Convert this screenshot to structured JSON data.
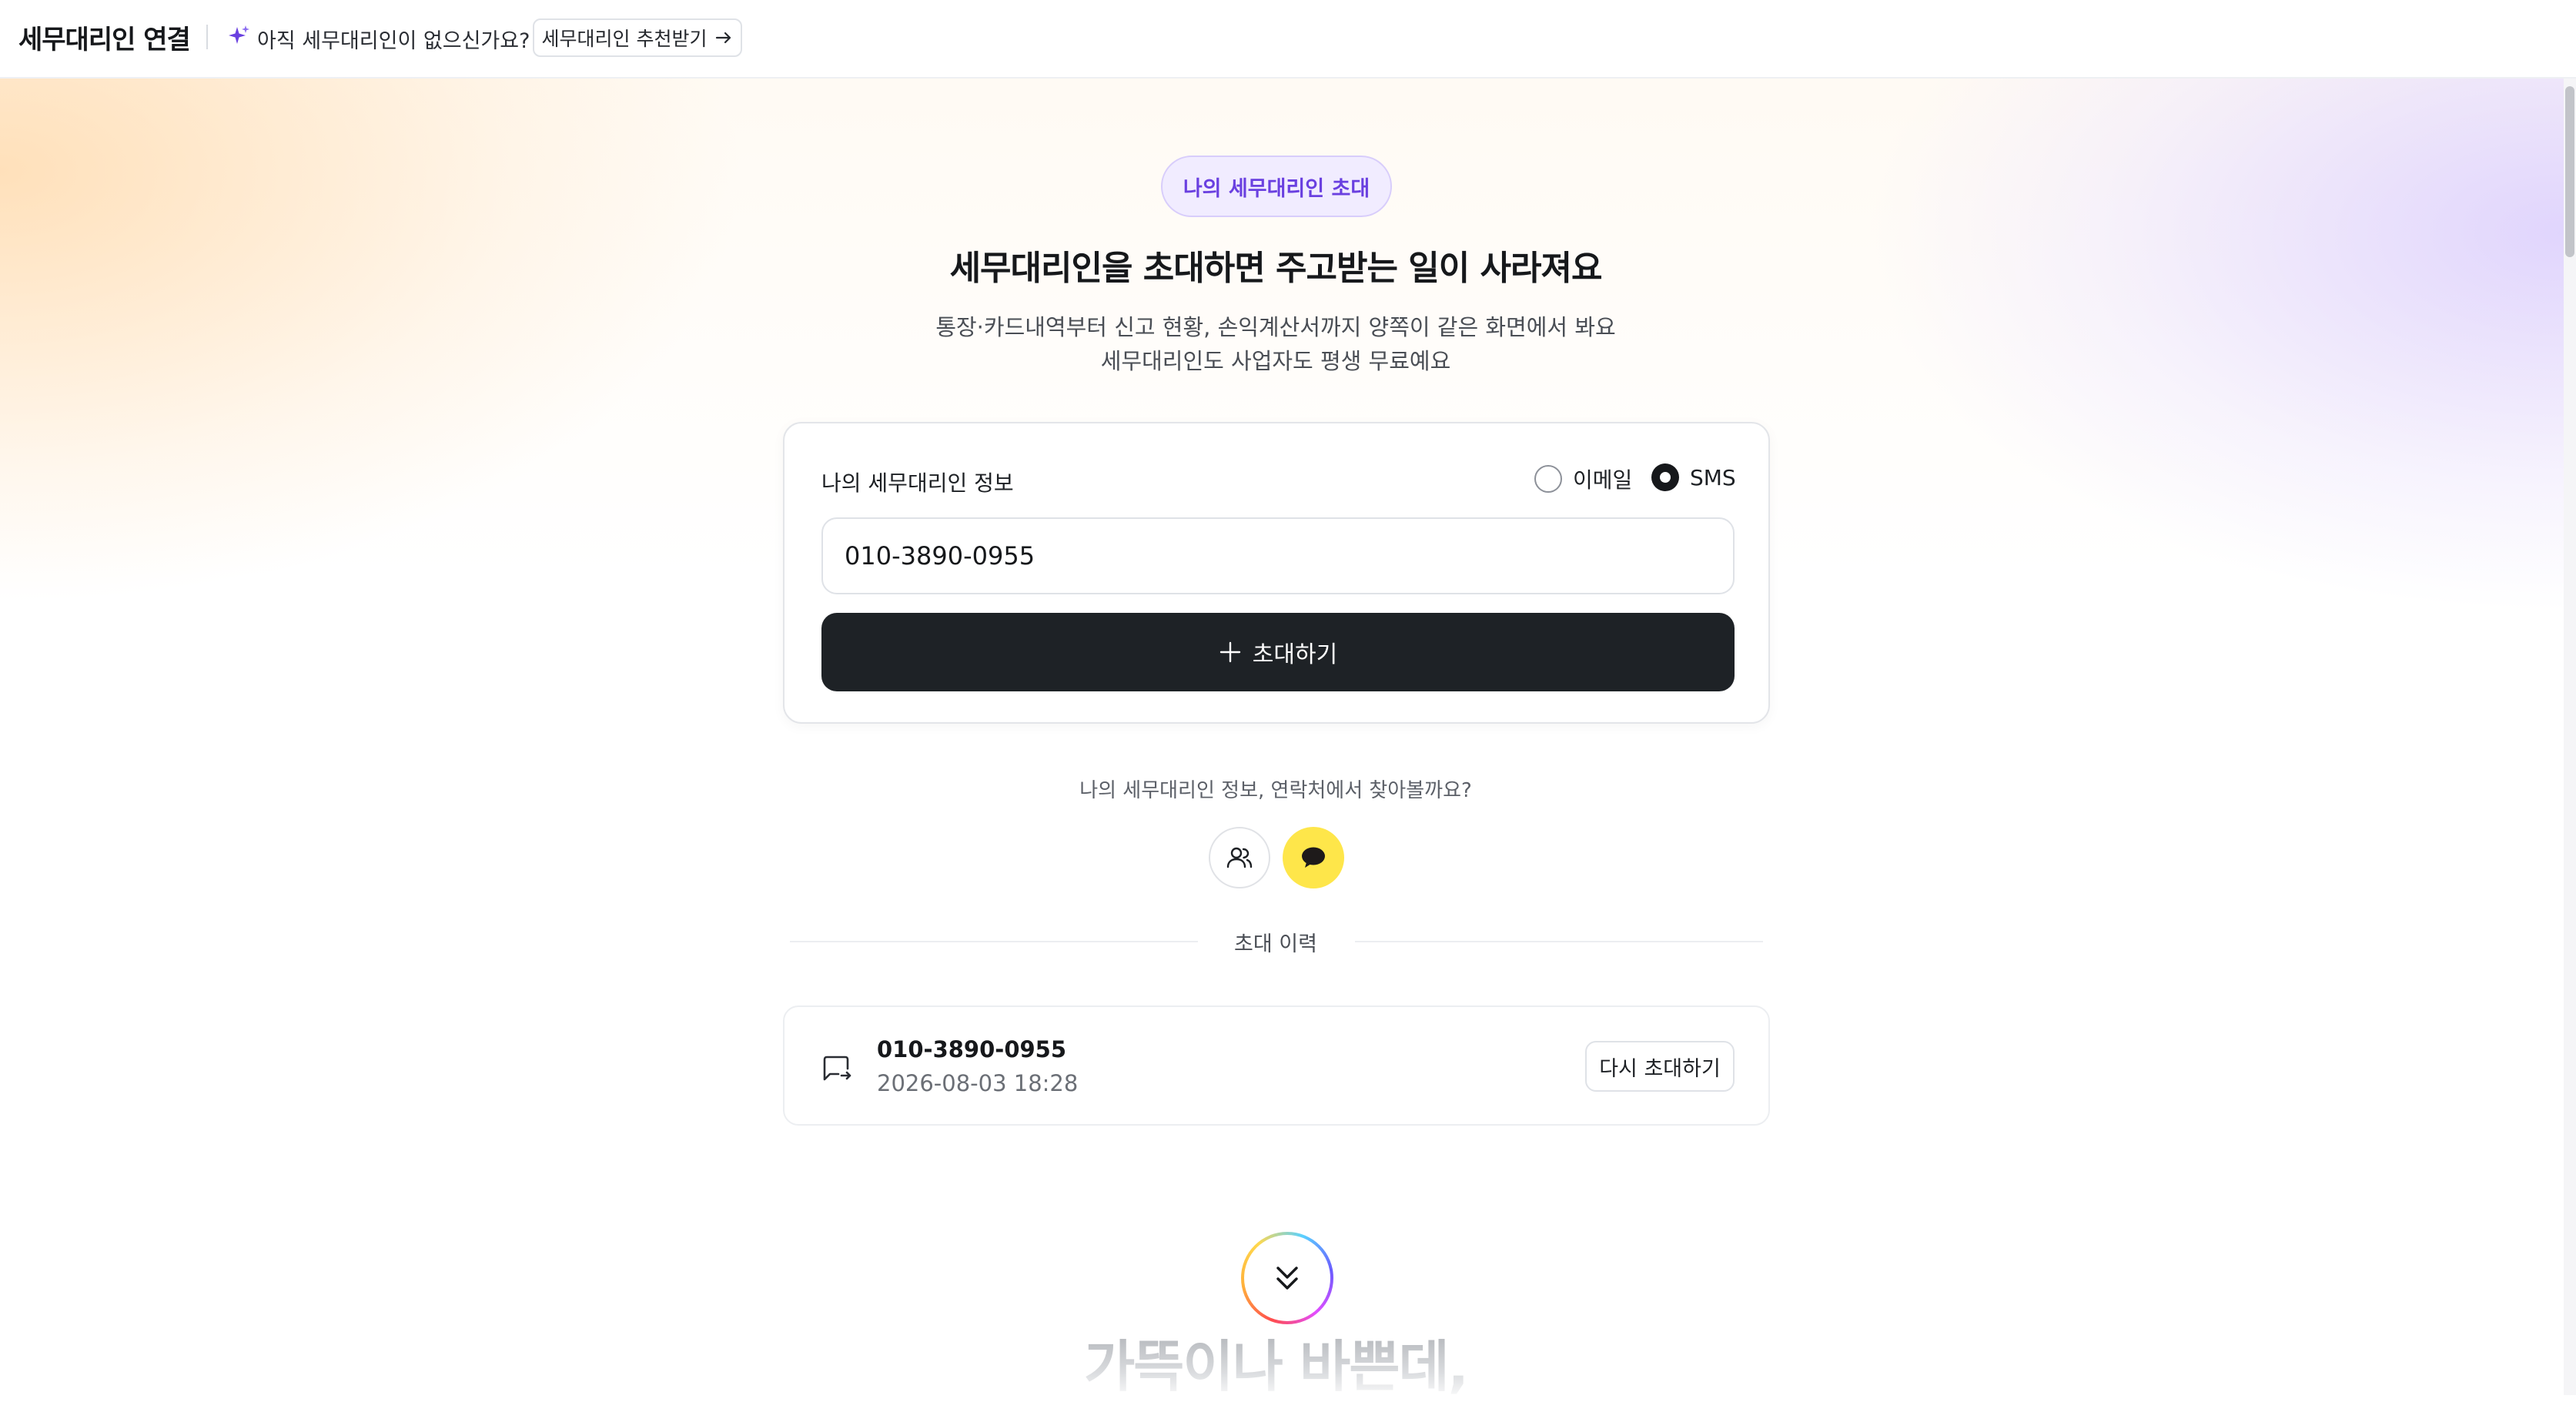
{
  "header": {
    "title": "세무대리인 연결",
    "promo_text": "아직 세무대리인이 없으신가요?",
    "recommend_button": "세무대리인 추천받기",
    "sparkle_color": "#6a40e0"
  },
  "hero": {
    "badge": "나의 세무대리인 초대",
    "headline": "세무대리인을 초대하면 주고받는 일이 사라져요",
    "sub_line1": "통장·카드내역부터 신고 현황, 손익계산서까지 양쪽이 같은 화면에서 봐요",
    "sub_line2": "세무대리인도 사업자도 평생 무료예요"
  },
  "form": {
    "label": "나의 세무대리인 정보",
    "radio_email": "이메일",
    "radio_sms": "SMS",
    "selected": "SMS",
    "phone_value": "010-3890-0955",
    "invite_button": "초대하기"
  },
  "contacts": {
    "prompt": "나의 세무대리인 정보, 연락처에서 찾아볼까요?",
    "icons": [
      "contacts-icon",
      "kakaotalk-icon"
    ]
  },
  "history": {
    "title": "초대 이력",
    "items": [
      {
        "phone": "010-3890-0955",
        "date": "2026-08-03 18:28",
        "action": "다시 초대하기"
      }
    ]
  },
  "teaser": {
    "text": "가뜩이나 바쁜데,"
  }
}
